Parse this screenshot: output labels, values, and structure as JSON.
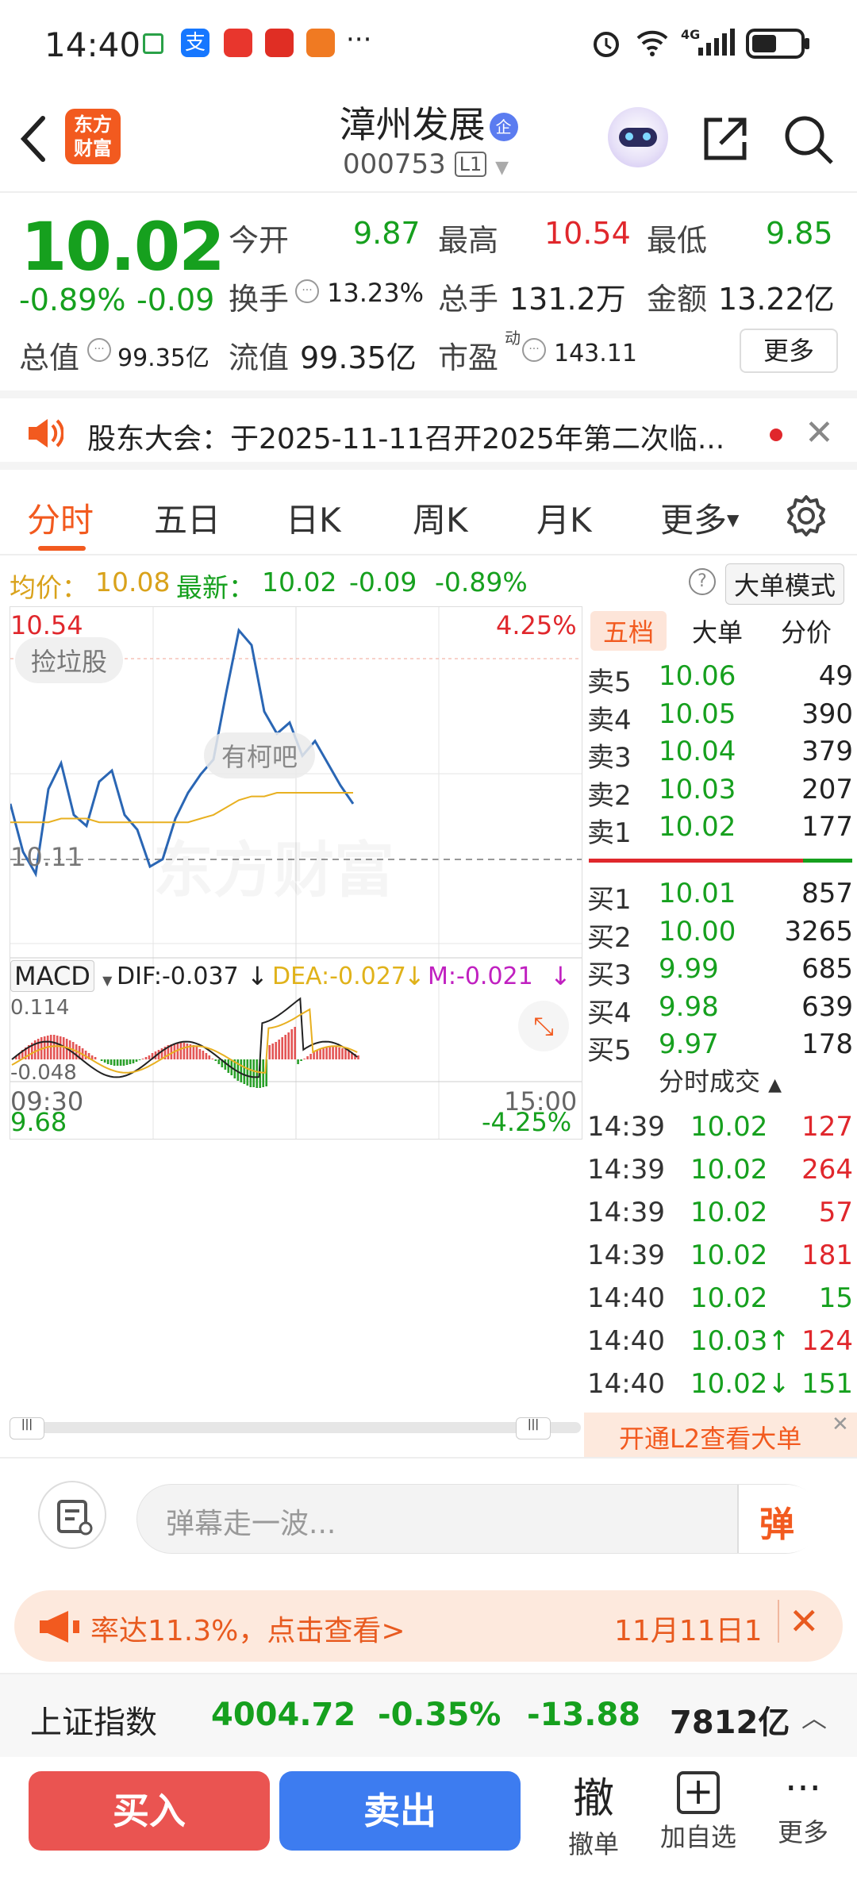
{
  "status_bar": {
    "time": "14:40",
    "more": "···",
    "network": "4G"
  },
  "header": {
    "title": "漳州发展",
    "code": "000753",
    "level": "L1",
    "qi_badge": "企",
    "logo_line1": "东方",
    "logo_line2": "财富"
  },
  "quote": {
    "price": "10.02",
    "change_pct": "-0.89%",
    "change": "-0.09",
    "open_label": "今开",
    "open": "9.87",
    "high_label": "最高",
    "high": "10.54",
    "low_label": "最低",
    "low": "9.85",
    "turnover_label": "换手",
    "turnover": "13.23%",
    "volume_label": "总手",
    "volume": "131.2万",
    "amount_label": "金额",
    "amount": "13.22亿",
    "mktcap_label": "总值",
    "mktcap": "99.35亿",
    "float_label": "流值",
    "float": "99.35亿",
    "pe_label": "市盈",
    "pe_sup": "动",
    "pe": "143.11",
    "more_label": "更多"
  },
  "notice": {
    "text": "股东大会：于2025-11-11召开2025年第二次临..."
  },
  "tabs": [
    "分时",
    "五日",
    "日K",
    "周K",
    "月K",
    "更多"
  ],
  "info_bar": {
    "avg_label": "均价：",
    "avg": "10.08",
    "latest_label": "最新：",
    "latest": "10.02",
    "chg": "-0.09",
    "pct": "-0.89%",
    "mode_label": "大单模式",
    "help": "?"
  },
  "chart": {
    "y_high": "10.54",
    "y_high_pct": "4.25%",
    "y_low": "9.68",
    "y_low_pct": "-4.25%",
    "prev_close": "10.11",
    "tag": "捡垃股",
    "bar_label": "有柯吧",
    "watermark": "东方财富",
    "macd_label": "MACD",
    "dif": "DIF:-0.037",
    "dea": "DEA:-0.027",
    "m": "M:-0.021",
    "macd_high": "0.114",
    "macd_low": "-0.048",
    "time_start": "09:30",
    "time_end": "15:00"
  },
  "chart_data": {
    "type": "line",
    "series": [
      {
        "name": "",
        "values": [
          10.05,
          9.92,
          9.86,
          10.09,
          10.16,
          10.02,
          9.99,
          10.11,
          10.14,
          10.02,
          9.98,
          9.88,
          9.9,
          10.01,
          10.08,
          10.13,
          10.17,
          10.35,
          10.52,
          10.48,
          10.3,
          10.24,
          10.27,
          10.18,
          10.22,
          10.16,
          10.1,
          10.05
        ]
      },
      {
        "name": "",
        "values": [
          10.0,
          10.0,
          10.0,
          10.0,
          10.01,
          10.01,
          10.01,
          10.0,
          10.0,
          10.0,
          10.0,
          10.0,
          10.0,
          10.0,
          10.0,
          10.01,
          10.02,
          10.04,
          10.06,
          10.07,
          10.07,
          10.08,
          10.08,
          10.08,
          10.08,
          10.08,
          10.08,
          10.08
        ]
      }
    ],
    "ylim": [
      9.68,
      10.54
    ]
  },
  "orderbook": {
    "tabs": [
      "五档",
      "大单",
      "分价"
    ],
    "asks": [
      {
        "label": "卖5",
        "price": "10.06",
        "vol": "49"
      },
      {
        "label": "卖4",
        "price": "10.05",
        "vol": "390"
      },
      {
        "label": "卖3",
        "price": "10.04",
        "vol": "379"
      },
      {
        "label": "卖2",
        "price": "10.03",
        "vol": "207"
      },
      {
        "label": "卖1",
        "price": "10.02",
        "vol": "177"
      }
    ],
    "bids": [
      {
        "label": "买1",
        "price": "10.01",
        "vol": "857"
      },
      {
        "label": "买2",
        "price": "10.00",
        "vol": "3265"
      },
      {
        "label": "买3",
        "price": "9.99",
        "vol": "685"
      },
      {
        "label": "买4",
        "price": "9.98",
        "vol": "639"
      },
      {
        "label": "买5",
        "price": "9.97",
        "vol": "178"
      }
    ],
    "trades_title": "分时成交",
    "trades": [
      {
        "t": "14:39",
        "p": "10.02",
        "v": "127",
        "c": "#e0272c"
      },
      {
        "t": "14:39",
        "p": "10.02",
        "v": "264",
        "c": "#e0272c"
      },
      {
        "t": "14:39",
        "p": "10.02",
        "v": "57",
        "c": "#e0272c"
      },
      {
        "t": "14:39",
        "p": "10.02",
        "v": "181",
        "c": "#e0272c"
      },
      {
        "t": "14:40",
        "p": "10.02",
        "v": "15",
        "c": "#16a01e"
      },
      {
        "t": "14:40",
        "p": "10.03↑",
        "v": "124",
        "c": "#e0272c"
      },
      {
        "t": "14:40",
        "p": "10.02↓",
        "v": "151",
        "c": "#16a01e"
      }
    ],
    "l2_promo": "开通L2查看大单"
  },
  "comment": {
    "placeholder": "弹幕走一波...",
    "danmu_btn": "弹"
  },
  "promo_bar": {
    "text": "率达11.3%，点击查看>",
    "date": "11月11日1"
  },
  "index_bar": {
    "name": "上证指数",
    "value": "4004.72",
    "pct": "-0.35%",
    "chg": "-13.88",
    "amount": "7812亿"
  },
  "actions": {
    "buy": "买入",
    "sell": "卖出",
    "cancel_big": "撤",
    "cancel": "撤单",
    "watch": "加自选",
    "more": "更多"
  }
}
